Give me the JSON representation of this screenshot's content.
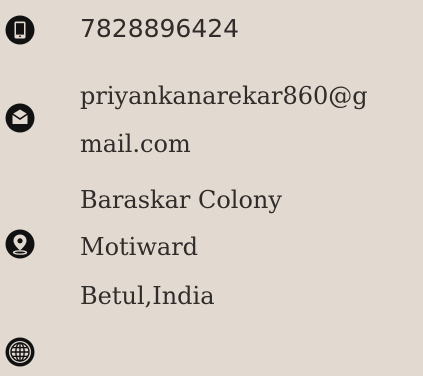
{
  "contact": {
    "phone": "7828896424",
    "email_line1": "priyankanarekar860@g",
    "email_line2": "mail.com",
    "address_line1": "Baraskar Colony",
    "address_line2": "Motiward",
    "address_line3": "Betul,India"
  },
  "icons": {
    "phone": "mobile-phone-icon",
    "email": "envelope-icon",
    "address": "map-pin-icon",
    "website": "globe-icon"
  },
  "colors": {
    "background": "#e2d9d1",
    "text": "#2f2c2a",
    "icon": "#111111"
  }
}
